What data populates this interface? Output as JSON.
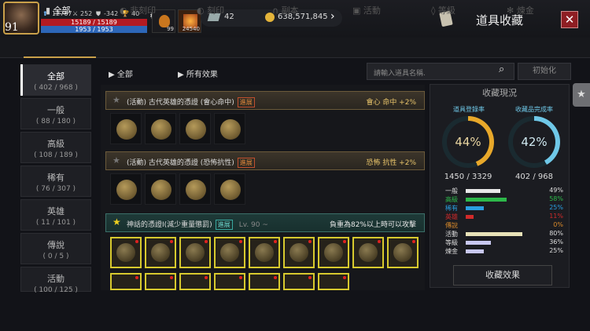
{
  "player": {
    "level": "91",
    "power": "12767",
    "stat2": "252",
    "stat3": "-342",
    "stat4": "40",
    "hp": "15189 / 15189",
    "mp": "1953 / 1953",
    "pot1": "99",
    "pot2": "24540"
  },
  "currency": {
    "gems": "42",
    "gold": "638,571,845"
  },
  "title": "道具收藏",
  "close": "✕",
  "tabs": [
    "全部",
    "非刻印",
    "刻印",
    "副本",
    "活動",
    "等級",
    "煉金"
  ],
  "sidebar": [
    {
      "label": "全部",
      "count": "( 402 / 968 )"
    },
    {
      "label": "一般",
      "count": "( 88 / 180 )"
    },
    {
      "label": "高級",
      "count": "( 108 / 189 )"
    },
    {
      "label": "稀有",
      "count": "( 76 / 307 )"
    },
    {
      "label": "英雄",
      "count": "( 11 / 101 )"
    },
    {
      "label": "傳說",
      "count": "( 0 / 5 )"
    },
    {
      "label": "活動",
      "count": "( 100 / 125 )"
    }
  ],
  "filters": {
    "category": "全部",
    "effect": "所有效果",
    "search_placeholder": "請輸入道具名稱.",
    "reset": "初始化"
  },
  "sets": [
    {
      "name": "(活動) 古代英雄的憑證 (會心命中)",
      "badge": "進展",
      "effect": "會心 命中 +2%"
    },
    {
      "name": "(活動) 古代英雄的憑證 (恐怖抗性)",
      "badge": "進展",
      "effect": "恐怖 抗性 +2%"
    },
    {
      "name": "神話的憑證I(減少重量懲罰)",
      "badge": "進展",
      "level": "Lv. 90 ~",
      "effect": "負重為82%以上時可以攻擊"
    }
  ],
  "panel": {
    "title": "收藏現況",
    "reg_label": "道具登錄率",
    "reg_pct": "44%",
    "reg_count": "1450 / 3329",
    "done_label": "收藏品完成率",
    "done_pct": "42%",
    "done_count": "402 / 968",
    "effect_btn": "收藏效果",
    "rows": [
      {
        "name": "一般",
        "pct": "49%",
        "value": 0.49,
        "color": "#e8e8e8"
      },
      {
        "name": "高級",
        "pct": "58%",
        "value": 0.58,
        "color": "#2db84a"
      },
      {
        "name": "稀有",
        "pct": "25%",
        "value": 0.25,
        "color": "#2a9fe0"
      },
      {
        "name": "英雄",
        "pct": "11%",
        "value": 0.11,
        "color": "#d02a2a"
      },
      {
        "name": "傳說",
        "pct": "0%",
        "value": 0,
        "color": "#d98a2a"
      },
      {
        "name": "活動",
        "pct": "80%",
        "value": 0.8,
        "color": "#e8e2b8"
      },
      {
        "name": "等級",
        "pct": "36%",
        "value": 0.36,
        "color": "#c8c8f0"
      },
      {
        "name": "煉金",
        "pct": "25%",
        "value": 0.25,
        "color": "#c8c8f0"
      }
    ]
  }
}
